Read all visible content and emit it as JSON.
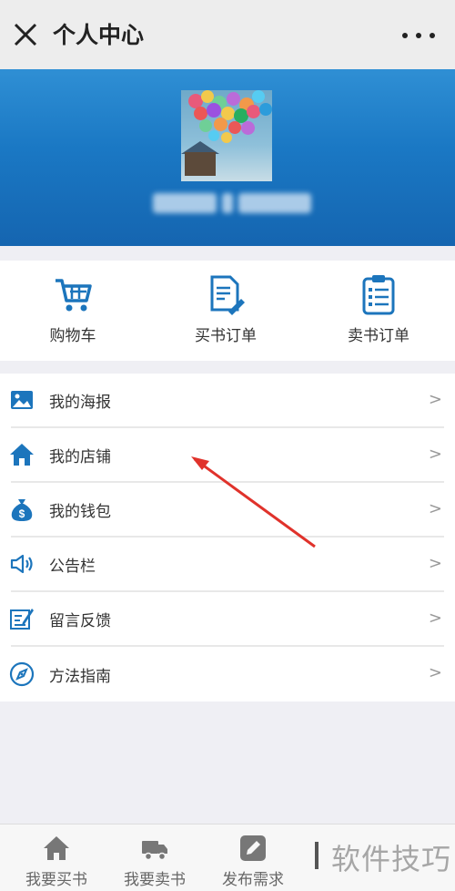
{
  "titlebar": {
    "title": "个人中心"
  },
  "quick_actions": [
    {
      "label": "购物车",
      "icon": "shopping-cart-icon"
    },
    {
      "label": "买书订单",
      "icon": "order-edit-icon"
    },
    {
      "label": "卖书订单",
      "icon": "clipboard-list-icon"
    }
  ],
  "menu": [
    {
      "label": "我的海报",
      "icon": "picture-icon",
      "chevron": ">"
    },
    {
      "label": "我的店铺",
      "icon": "home-icon",
      "chevron": ">"
    },
    {
      "label": "我的钱包",
      "icon": "money-bag-icon",
      "chevron": ">"
    },
    {
      "label": "公告栏",
      "icon": "speaker-icon",
      "chevron": ">"
    },
    {
      "label": "留言反馈",
      "icon": "feedback-edit-icon",
      "chevron": ">"
    },
    {
      "label": "方法指南",
      "icon": "compass-icon",
      "chevron": ">"
    }
  ],
  "tabbar": [
    {
      "label": "我要买书",
      "icon": "home-icon"
    },
    {
      "label": "我要卖书",
      "icon": "truck-icon"
    },
    {
      "label": "发布需求",
      "icon": "edit-icon"
    }
  ],
  "watermark": "软件技巧",
  "colors": {
    "accent": "#1c75bc",
    "header_top": "#2f8fd4",
    "header_bottom": "#1565b0",
    "annotation": "#e0322b"
  }
}
